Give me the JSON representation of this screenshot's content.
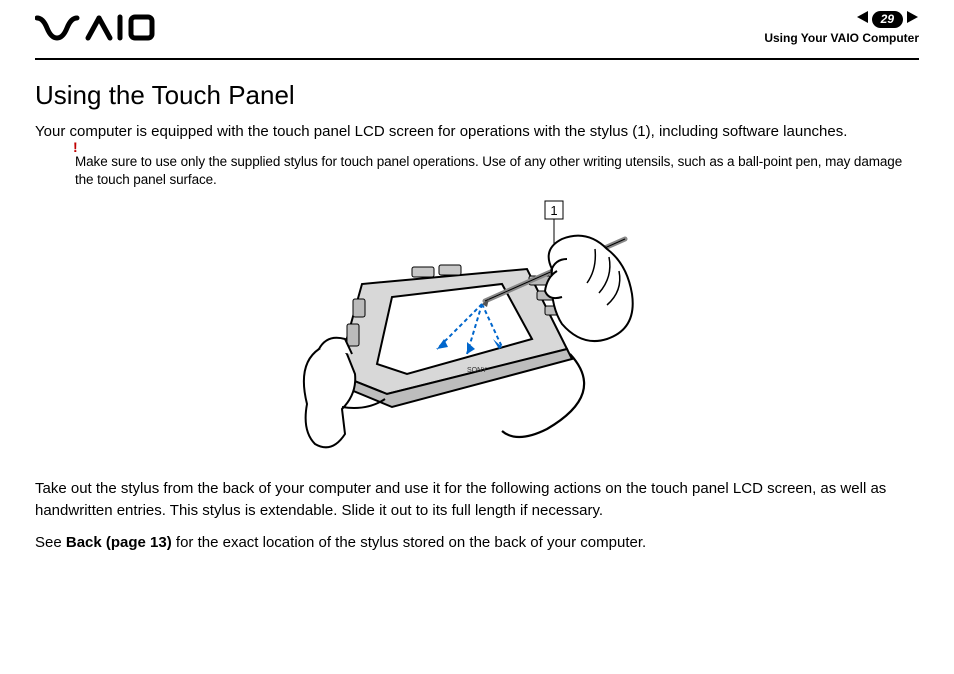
{
  "header": {
    "page_number": "29",
    "section": "Using Your VAIO Computer"
  },
  "title": "Using the Touch Panel",
  "p1": "Your computer is equipped with the touch panel LCD screen for operations with the stylus (1), including software launches.",
  "caution": {
    "mark": "!",
    "text": "Make sure to use only the supplied stylus for touch panel operations. Use of any other writing utensils, such as a ball-point pen, may damage the touch panel surface."
  },
  "figure": {
    "callout": "1"
  },
  "p2": "Take out the stylus from the back of your computer and use it for the following actions on the touch panel LCD screen, as well as handwritten entries. This stylus is extendable. Slide it out to its full length if necessary.",
  "p3_prefix": "See ",
  "p3_link": "Back (page 13)",
  "p3_suffix": " for the exact location of the stylus stored on the back of your computer."
}
